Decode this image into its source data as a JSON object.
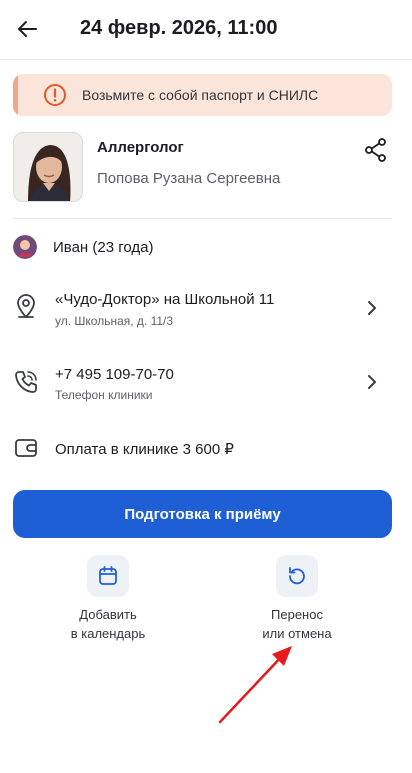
{
  "header": {
    "title": "24 февр. 2026, 11:00",
    "back_icon": "arrow-left-icon"
  },
  "alert": {
    "text": "Возьмите с собой паспорт и СНИЛС",
    "icon": "warning-circle-icon",
    "bg_color": "#fbe4da",
    "accent_color": "#e05a2b"
  },
  "doctor": {
    "specialty": "Аллерголог",
    "name": "Попова Рузана Сергеевна",
    "share_icon": "share-icon"
  },
  "patient": {
    "name": "Иван (23 года)"
  },
  "clinic": {
    "title": "«Чудо-Доктор» на Школьной 11",
    "address": "ул. Школьная, д. 11/3",
    "icon": "location-pin-icon"
  },
  "phone": {
    "number": "+7 495 109-70-70",
    "label": "Телефон клиники",
    "icon": "phone-icon"
  },
  "payment": {
    "text": "Оплата в клинике 3 600 ₽",
    "icon": "wallet-icon"
  },
  "primary_button": {
    "label": "Подготовка к приёму",
    "color": "#1f5fd6"
  },
  "actions": {
    "calendar": {
      "line1": "Добавить",
      "line2": "в календарь",
      "icon": "calendar-icon"
    },
    "reschedule": {
      "line1": "Перенос",
      "line2": "или отмена",
      "icon": "undo-icon"
    }
  },
  "annotation": {
    "arrow_color": "#e8191c"
  }
}
